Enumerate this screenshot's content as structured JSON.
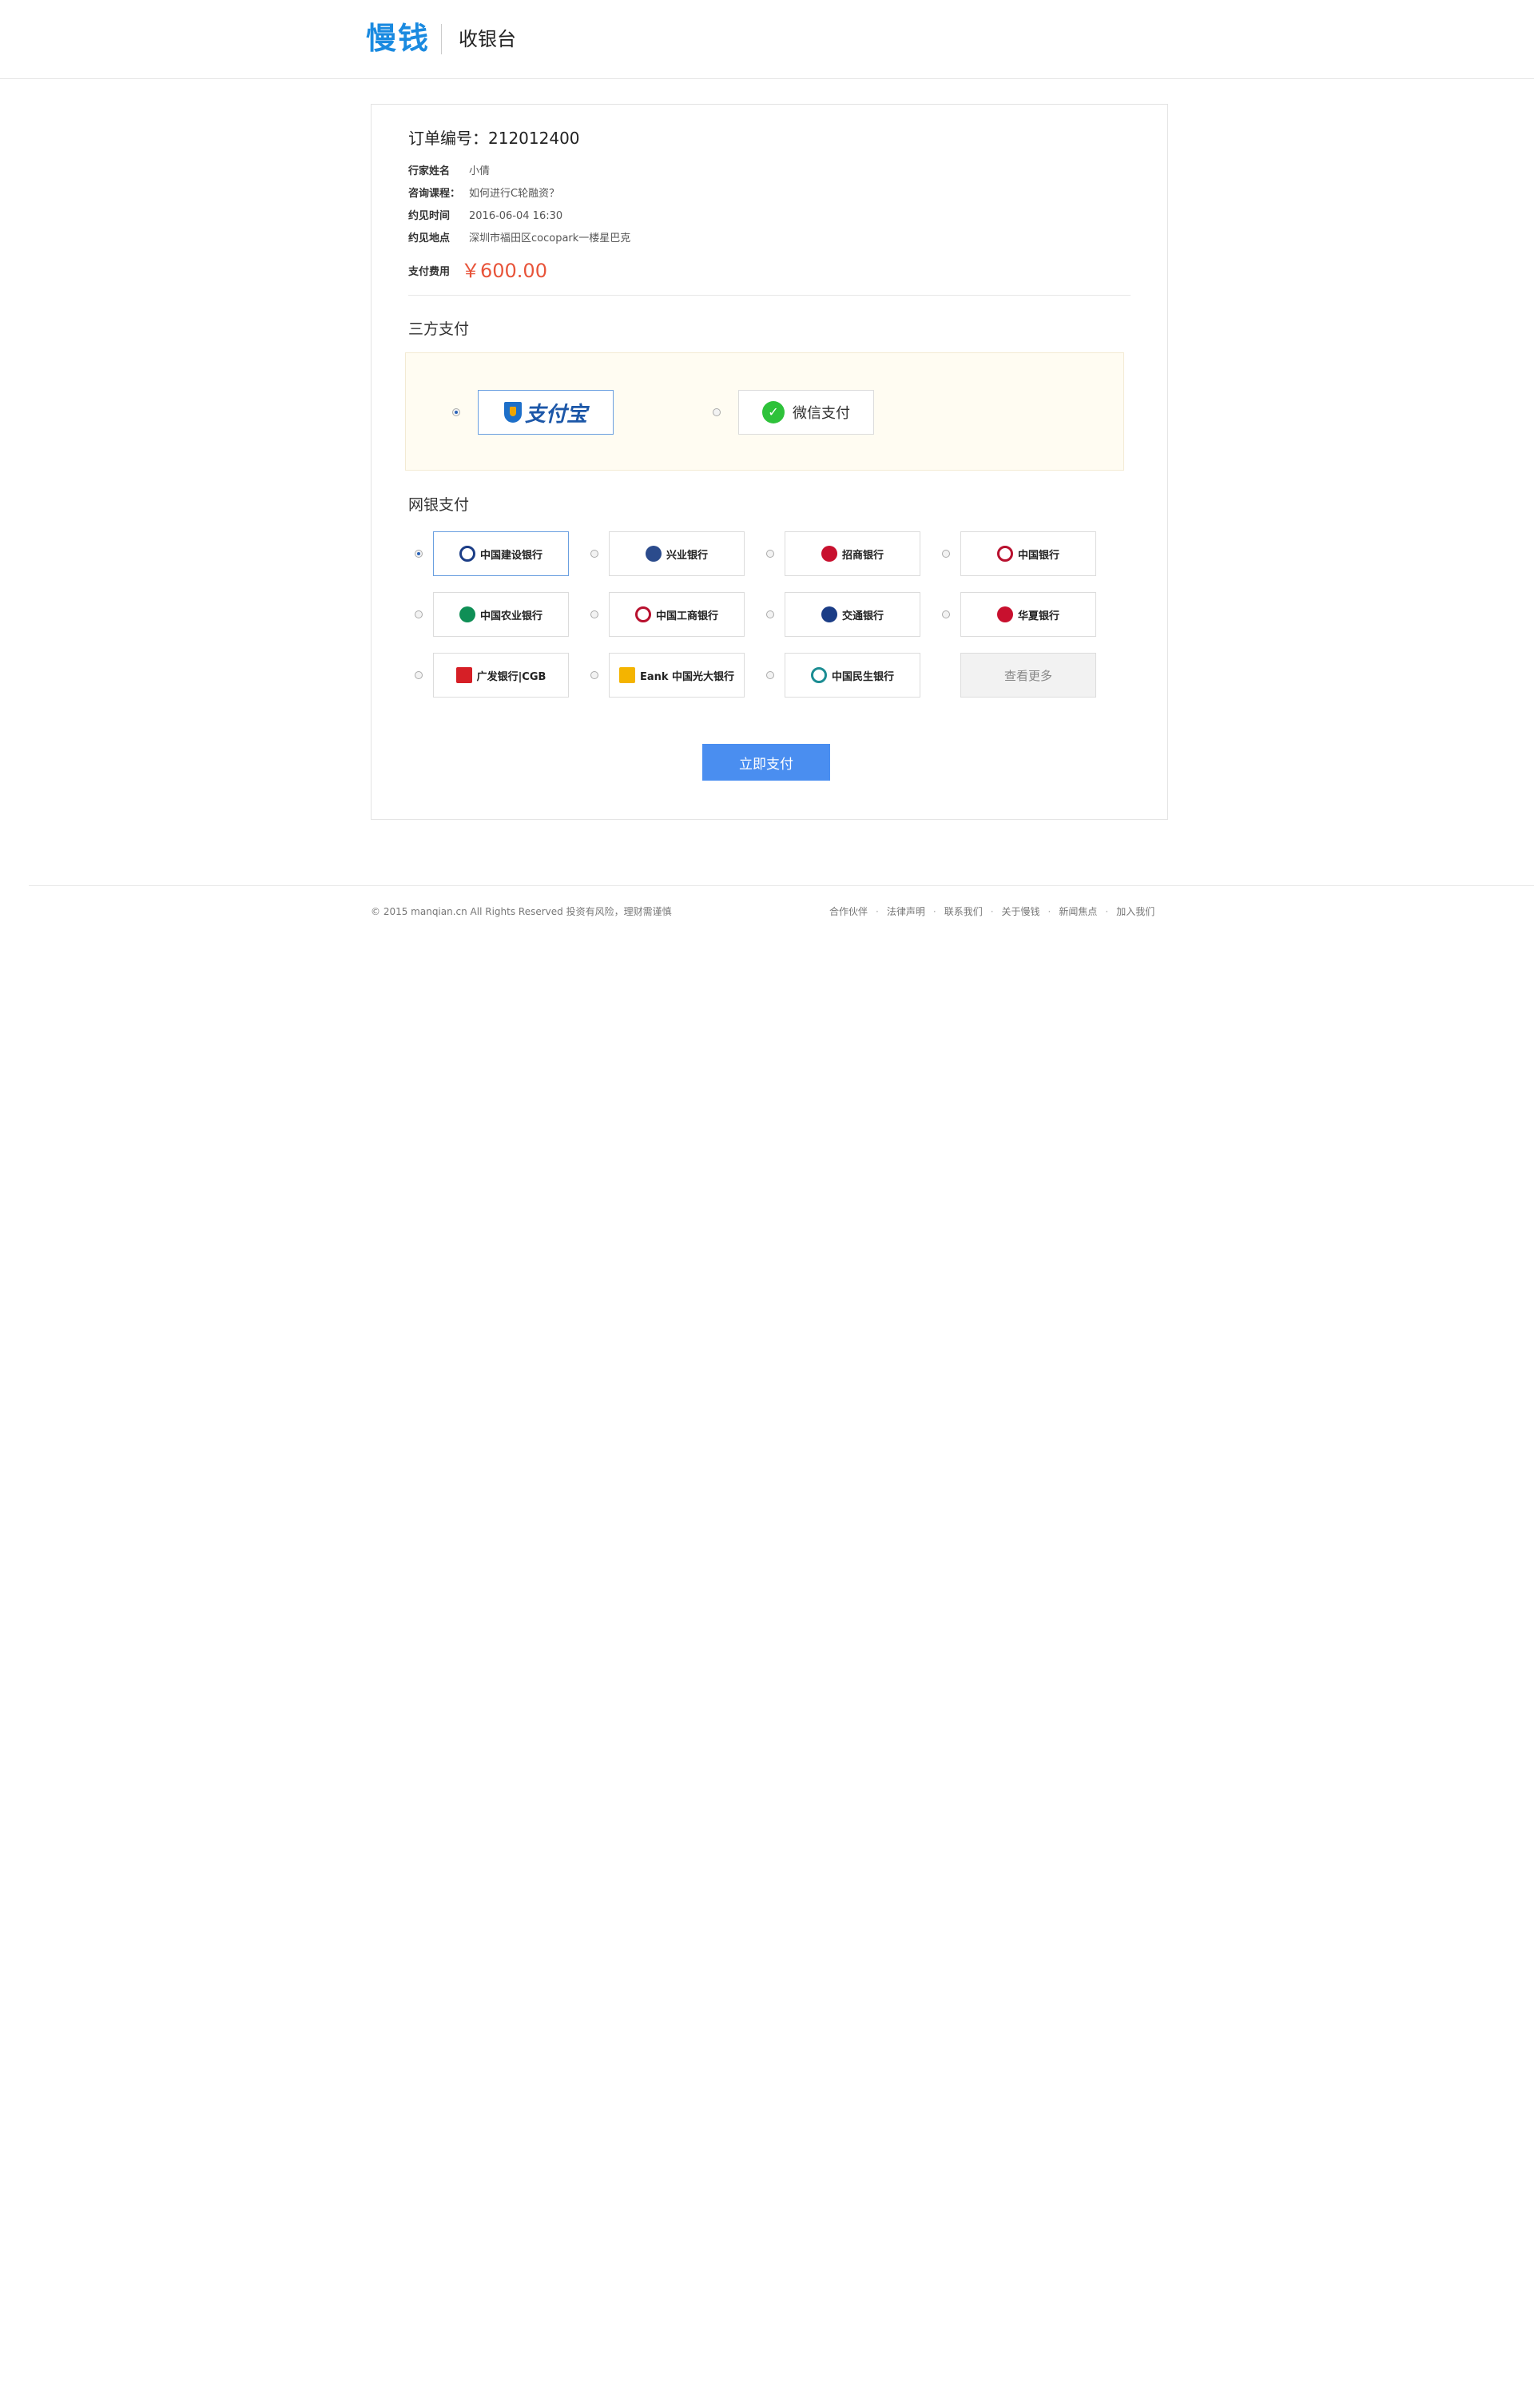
{
  "header": {
    "logo": "慢钱",
    "title": "收银台"
  },
  "order": {
    "order_no_label": "订单编号：",
    "order_no": "212012400",
    "rows": [
      {
        "label": "行家姓名",
        "value": "小倩"
      },
      {
        "label": "咨询课程：",
        "value": "如何进行C轮融资？"
      },
      {
        "label": "约见时间",
        "value": "2016-06-04 16:30"
      },
      {
        "label": "约见地点",
        "value": "深圳市福田区cocopark一楼星巴克"
      }
    ],
    "fee_label": "支付费用",
    "fee_value": "￥600.00"
  },
  "third_party": {
    "title": "三方支付",
    "options": [
      {
        "name": "支付宝",
        "selected": true
      },
      {
        "name": "微信支付",
        "selected": false
      }
    ]
  },
  "bank": {
    "title": "网银支付",
    "options": [
      {
        "name": "中国建设银行",
        "selected": true
      },
      {
        "name": "兴业银行",
        "selected": false
      },
      {
        "name": "招商银行",
        "selected": false
      },
      {
        "name": "中国银行",
        "selected": false
      },
      {
        "name": "中国农业银行",
        "selected": false
      },
      {
        "name": "中国工商银行",
        "selected": false
      },
      {
        "name": "交通银行",
        "selected": false
      },
      {
        "name": "华夏银行",
        "selected": false
      },
      {
        "name": "广发银行|CGB",
        "selected": false
      },
      {
        "name": "Eank 中国光大银行",
        "selected": false
      },
      {
        "name": "中国民生银行",
        "selected": false
      }
    ],
    "more_label": "查看更多"
  },
  "submit_label": "立即支付",
  "footer": {
    "copyright": "© 2015 manqian.cn All Rights Reserved 投资有风险，理财需谨慎",
    "links": [
      "合作伙伴",
      "法律声明",
      "联系我们",
      "关于慢钱",
      "新闻焦点",
      "加入我们"
    ],
    "separator": "·"
  },
  "colors": {
    "brand": "#1a8ae0",
    "price": "#e8543a",
    "button": "#4a8ef0",
    "third_party_bg": "#fffcf2"
  }
}
